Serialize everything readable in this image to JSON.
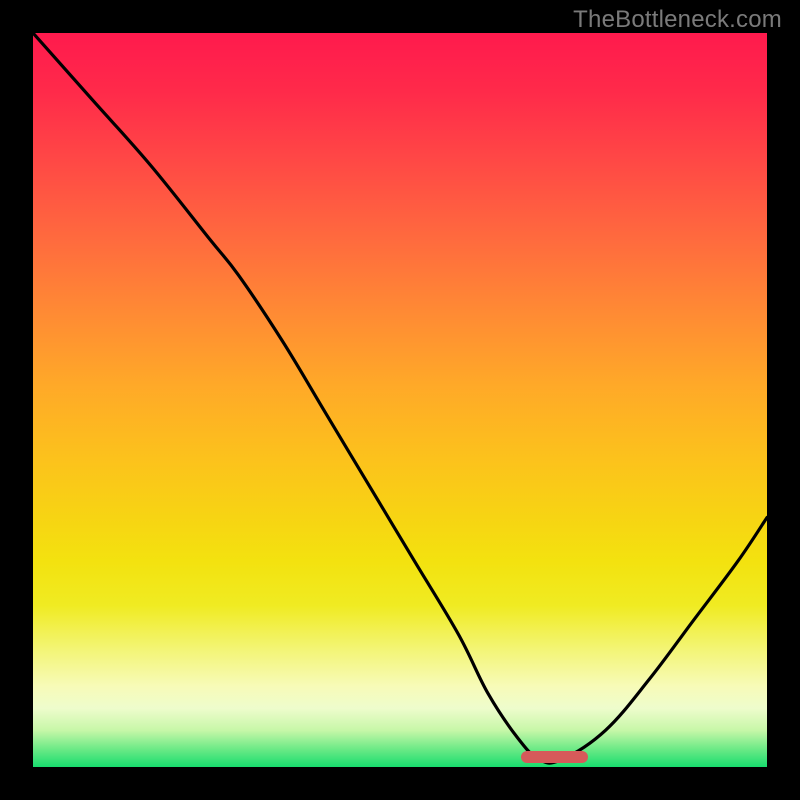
{
  "watermark": "TheBottleneck.com",
  "chart_data": {
    "type": "line",
    "title": "",
    "xlabel": "",
    "ylabel": "",
    "xlim": [
      0,
      100
    ],
    "ylim": [
      0,
      100
    ],
    "grid": false,
    "legend": false,
    "series": [
      {
        "name": "bottleneck-curve",
        "x": [
          0,
          8,
          16,
          24,
          28,
          34,
          40,
          46,
          52,
          58,
          62,
          66,
          69,
          72,
          78,
          84,
          90,
          96,
          100
        ],
        "y": [
          100,
          91,
          82,
          72,
          67,
          58,
          48,
          38,
          28,
          18,
          10,
          4,
          1,
          1,
          5,
          12,
          20,
          28,
          34
        ]
      }
    ],
    "marker": {
      "x_start": 66,
      "x_end": 75,
      "y": 0,
      "color": "#d65a5a"
    },
    "gradient_stops": [
      {
        "pos": 0,
        "color": "#ff1a4d"
      },
      {
        "pos": 0.5,
        "color": "#ffb020"
      },
      {
        "pos": 0.85,
        "color": "#f3f576"
      },
      {
        "pos": 1.0,
        "color": "#18dd6e"
      }
    ]
  }
}
